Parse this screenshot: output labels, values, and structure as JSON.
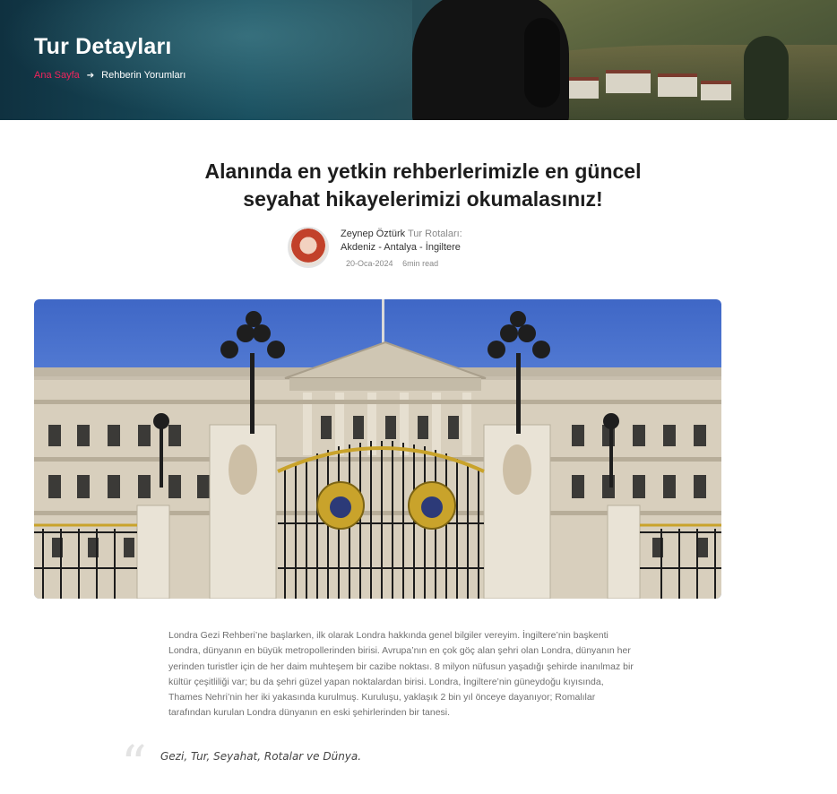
{
  "hero": {
    "title": "Tur Detayları",
    "breadcrumb": {
      "home": "Ana Sayfa",
      "current": "Rehberin Yorumları"
    }
  },
  "article": {
    "title_line1": "Alanında en yetkin rehberlerimizle en güncel",
    "title_line2": "seyahat hikayelerimizi okumalasınız!",
    "author": {
      "name": "Zeynep Öztürk",
      "routes_label": "Tur Rotaları:",
      "routes": "Akdeniz - Antalya - İngiltere",
      "date": "20-Oca-2024",
      "read_time": "6min read"
    },
    "body": "Londra Gezi Rehberi’ne başlarken, ilk olarak Londra hakkında genel bilgiler vereyim. İngiltere’nin başkenti Londra, dünyanın en büyük metropollerinden birisi. Avrupa’nın en çok göç alan şehri olan Londra, dünyanın her yerinden turistler için de her daim muhteşem bir cazibe noktası. 8 milyon nüfusun yaşadığı şehirde inanılmaz bir kültür çeşitliliği var; bu da şehri güzel yapan noktalardan birisi. Londra, İngiltere’nin güneydoğu kıyısında, Thames Nehri’nin her iki yakasında kurulmuş. Kuruluşu, yaklaşık 2 bin yıl önceye dayanıyor; Romalılar tarafından kurulan Londra dünyanın en eski şehirlerinden bir tanesi.",
    "quote": "Gezi, Tur, Seyahat, Rotalar ve Dünya.",
    "quote_mark": "“"
  },
  "colors": {
    "accent": "#f0245c",
    "body_text": "#6f6f6f",
    "title_text": "#1d1d1d"
  }
}
